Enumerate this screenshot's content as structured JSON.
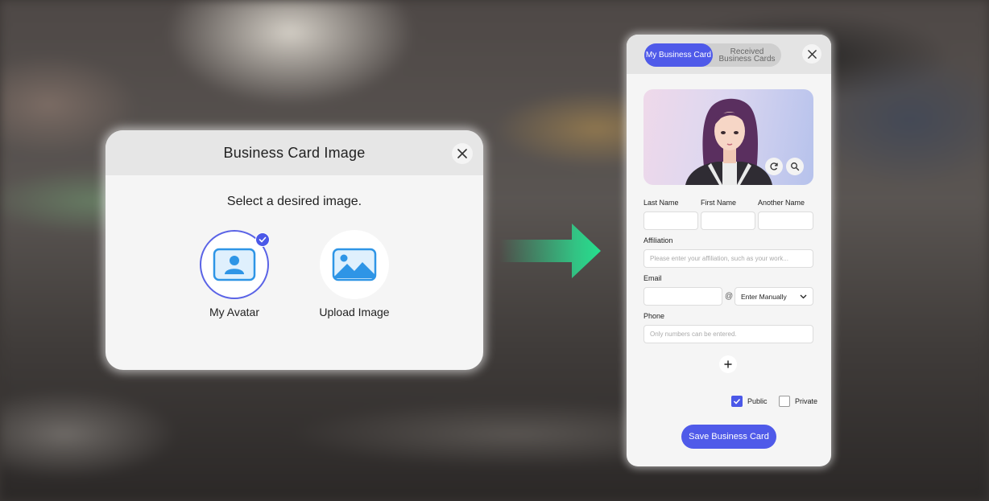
{
  "dialog": {
    "title": "Business Card Image",
    "subtitle": "Select a desired image.",
    "options": [
      {
        "label": "My Avatar",
        "icon": "avatar-image-icon",
        "selected": true
      },
      {
        "label": "Upload Image",
        "icon": "landscape-image-icon",
        "selected": false
      }
    ]
  },
  "panel": {
    "tabs": [
      {
        "label": "My Business Card",
        "active": true
      },
      {
        "label": "Received Business Cards",
        "active": false
      }
    ],
    "fields": {
      "last_name_label": "Last Name",
      "first_name_label": "First Name",
      "another_name_label": "Another Name",
      "affiliation_label": "Affiliation",
      "affiliation_placeholder": "Please enter your affiliation, such as your work...",
      "email_label": "Email",
      "email_at": "@",
      "email_domain_selected": "Enter Manually",
      "phone_label": "Phone",
      "phone_placeholder": "Only numbers can be entered."
    },
    "visibility": {
      "public_label": "Public",
      "public_checked": true,
      "private_label": "Private",
      "private_checked": false
    },
    "save_label": "Save Business Card"
  },
  "colors": {
    "accent": "#4f5ae9",
    "arrow": "#2fd08a"
  }
}
